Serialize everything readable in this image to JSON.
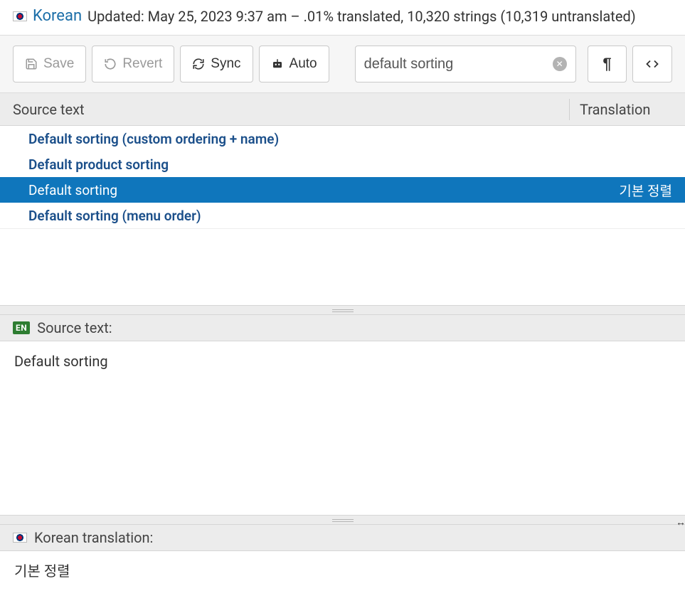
{
  "header": {
    "language": "Korean",
    "meta": "Updated: May 25, 2023 9:37 am – .01% translated, 10,320 strings (10,319 untranslated)"
  },
  "toolbar": {
    "save": "Save",
    "revert": "Revert",
    "sync": "Sync",
    "auto": "Auto",
    "search_value": "default sorting"
  },
  "columns": {
    "source": "Source text",
    "translation": "Translation"
  },
  "rows": [
    {
      "src": "Default sorting (custom ordering + name)",
      "trn": "",
      "selected": false
    },
    {
      "src": "Default product sorting",
      "trn": "",
      "selected": false
    },
    {
      "src": "Default sorting",
      "trn": "기본 정렬",
      "selected": true
    },
    {
      "src": "Default sorting (menu order)",
      "trn": "",
      "selected": false
    }
  ],
  "source_pane": {
    "badge": "EN",
    "label": "Source text:",
    "value": "Default sorting"
  },
  "translation_pane": {
    "label": "Korean translation:",
    "value": "기본 정렬"
  }
}
